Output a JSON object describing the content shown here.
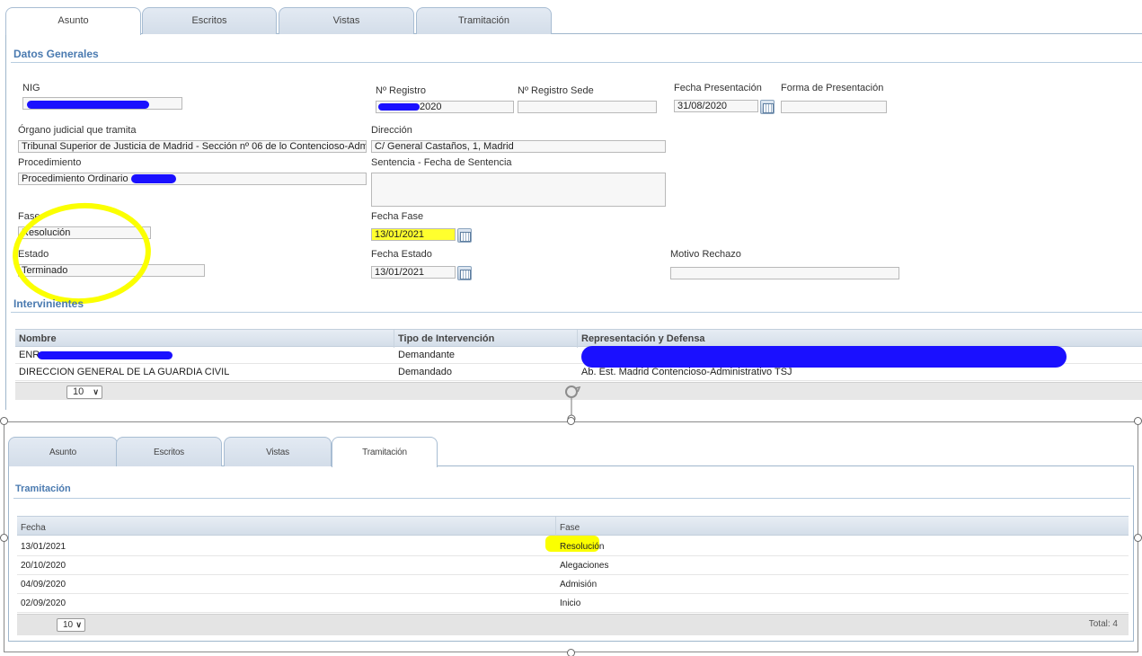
{
  "top": {
    "tabs": [
      {
        "label": "Asunto",
        "active": true
      },
      {
        "label": "Escritos",
        "active": false
      },
      {
        "label": "Vistas",
        "active": false
      },
      {
        "label": "Tramitación",
        "active": false
      }
    ],
    "datos_generales": {
      "title": "Datos Generales",
      "nig_label": "NIG",
      "nig_value": "",
      "nregistro_label": "Nº Registro",
      "nregistro_value": "2020",
      "nregistro_sede_label": "Nº Registro Sede",
      "nregistro_sede_value": "",
      "fecha_presentacion_label": "Fecha Presentación",
      "fecha_presentacion_value": "31/08/2020",
      "forma_presentacion_label": "Forma de Presentación",
      "forma_presentacion_value": "",
      "organo_label": "Órgano judicial que tramita",
      "organo_value": "Tribunal Superior de Justicia de Madrid - Sección nº 06 de lo Contencioso-Adm",
      "direccion_label": "Dirección",
      "direccion_value": "C/ General Castaños, 1, Madrid",
      "procedimiento_label": "Procedimiento",
      "procedimiento_value": "Procedimiento Ordinario",
      "sentencia_label": "Sentencia - Fecha de Sentencia",
      "sentencia_value": "",
      "fase_label": "Fase",
      "fase_value": "Resolución",
      "fecha_fase_label": "Fecha Fase",
      "fecha_fase_value": "13/01/2021",
      "estado_label": "Estado",
      "estado_value": "Terminado",
      "fecha_estado_label": "Fecha Estado",
      "fecha_estado_value": "13/01/2021",
      "motivo_rechazo_label": "Motivo Rechazo",
      "motivo_rechazo_value": ""
    },
    "intervinientes": {
      "title": "Intervinientes",
      "columns": [
        "Nombre",
        "Tipo de Intervención",
        "Representación y Defensa"
      ],
      "rows": [
        {
          "nombre": "ENR",
          "tipo": "Demandante",
          "representacion": ""
        },
        {
          "nombre": "DIRECCION GENERAL DE LA GUARDIA CIVIL",
          "tipo": "Demandado",
          "representacion": "Ab. Est. Madrid Contencioso-Administrativo TSJ"
        }
      ],
      "page_size": "10"
    }
  },
  "bottom": {
    "tabs": [
      {
        "label": "Asunto",
        "active": false
      },
      {
        "label": "Escritos",
        "active": false
      },
      {
        "label": "Vistas",
        "active": false
      },
      {
        "label": "Tramitación",
        "active": true
      }
    ],
    "tramitacion": {
      "title": "Tramitación",
      "columns": [
        "Fecha",
        "Fase"
      ],
      "rows": [
        {
          "fecha": "13/01/2021",
          "fase": "Resolución"
        },
        {
          "fecha": "20/10/2020",
          "fase": "Alegaciones"
        },
        {
          "fecha": "04/09/2020",
          "fase": "Admisión"
        },
        {
          "fecha": "02/09/2020",
          "fase": "Inicio"
        }
      ],
      "page_size": "10",
      "total": "Total: 4"
    }
  },
  "colors": {
    "highlight": "#fbff00",
    "redaction": "#1a10ff",
    "section_title": "#4a7ab0"
  },
  "icons": [
    "calendar-icon",
    "refresh-icon",
    "chevron-down-icon"
  ]
}
